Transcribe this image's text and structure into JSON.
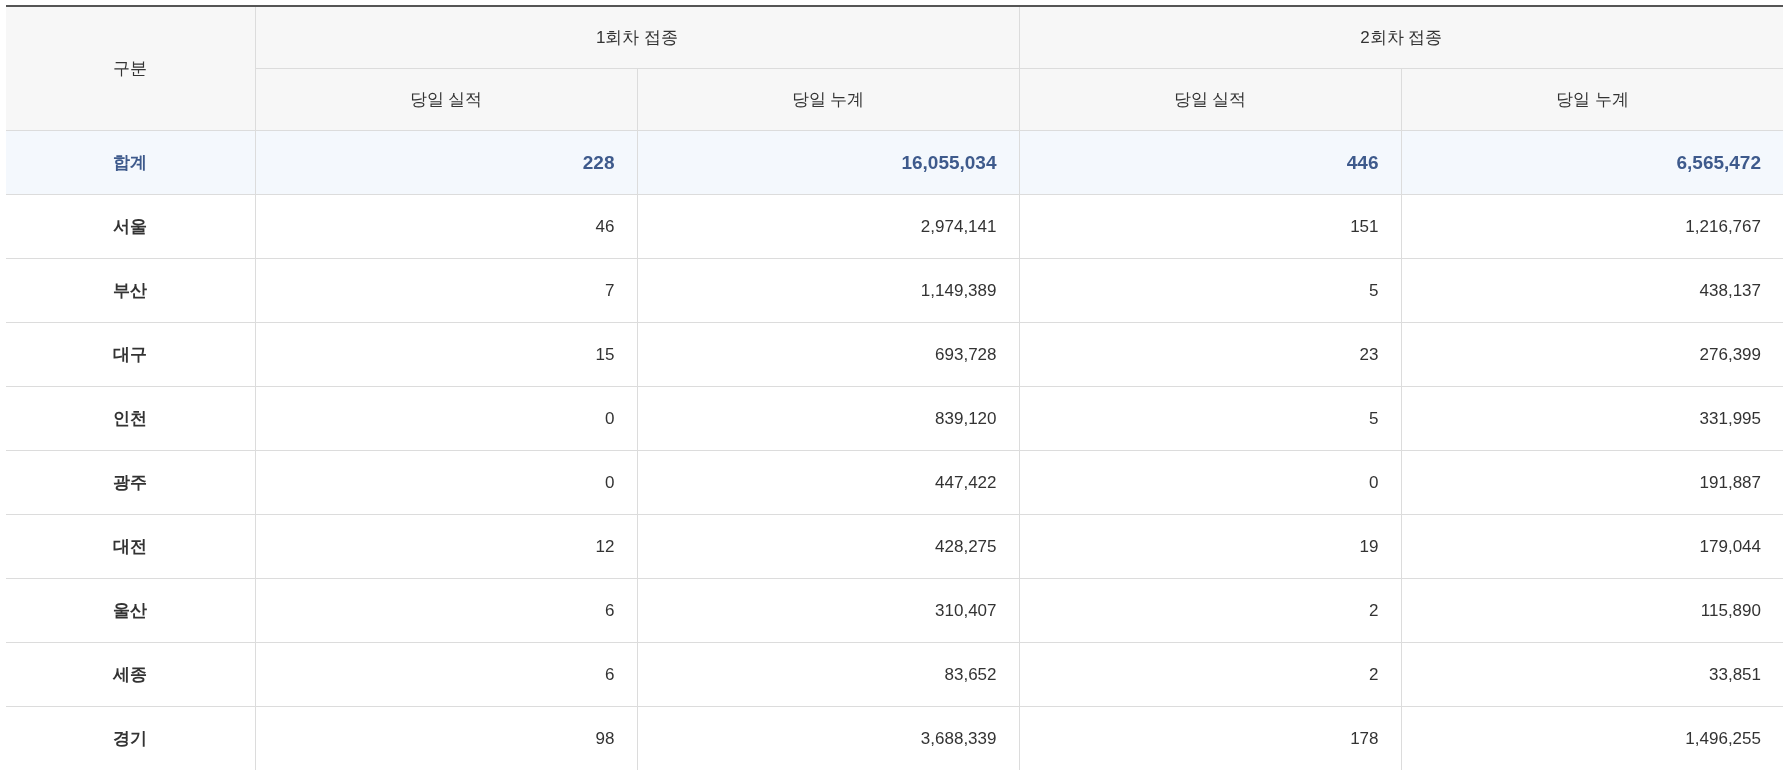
{
  "table": {
    "corner_header": "구분",
    "group_headers": [
      "1회차 접종",
      "2회차 접종"
    ],
    "sub_headers": [
      "당일 실적",
      "당일 누계",
      "당일 실적",
      "당일 누계"
    ],
    "rows": [
      {
        "kind": "total",
        "label": "합계",
        "cells": [
          "228",
          "16,055,034",
          "446",
          "6,565,472"
        ]
      },
      {
        "kind": "region",
        "label": "서울",
        "cells": [
          "46",
          "2,974,141",
          "151",
          "1,216,767"
        ]
      },
      {
        "kind": "region",
        "label": "부산",
        "cells": [
          "7",
          "1,149,389",
          "5",
          "438,137"
        ]
      },
      {
        "kind": "region",
        "label": "대구",
        "cells": [
          "15",
          "693,728",
          "23",
          "276,399"
        ]
      },
      {
        "kind": "region",
        "label": "인천",
        "cells": [
          "0",
          "839,120",
          "5",
          "331,995"
        ]
      },
      {
        "kind": "region",
        "label": "광주",
        "cells": [
          "0",
          "447,422",
          "0",
          "191,887"
        ]
      },
      {
        "kind": "region",
        "label": "대전",
        "cells": [
          "12",
          "428,275",
          "19",
          "179,044"
        ]
      },
      {
        "kind": "region",
        "label": "울산",
        "cells": [
          "6",
          "310,407",
          "2",
          "115,890"
        ]
      },
      {
        "kind": "region",
        "label": "세종",
        "cells": [
          "6",
          "83,652",
          "2",
          "33,851"
        ]
      },
      {
        "kind": "region",
        "label": "경기",
        "cells": [
          "98",
          "3,688,339",
          "178",
          "1,496,255"
        ]
      }
    ]
  }
}
